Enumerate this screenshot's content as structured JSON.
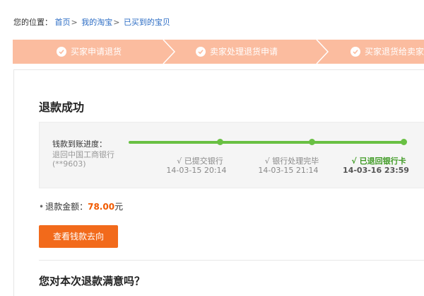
{
  "breadcrumb": {
    "prefix": "您的位置：",
    "items": [
      "首页",
      "我的淘宝",
      "已买到的宝贝"
    ],
    "separator": ">"
  },
  "steps": [
    {
      "label": "买家申请退货",
      "icon": "check-circle-icon"
    },
    {
      "label": "卖家处理退货申请",
      "icon": "check-circle-icon"
    },
    {
      "label": "买家退货给卖家",
      "icon": "check-circle-icon"
    }
  ],
  "refund": {
    "title": "退款成功",
    "progress_label": "钱款到账进度：",
    "destination": "退回中国工商银行",
    "card": "(**9603)",
    "stages": [
      {
        "status": "√ 已提交银行",
        "time": "14-03-15 20:14"
      },
      {
        "status": "√ 银行处理完毕",
        "time": "14-03-15 21:14"
      },
      {
        "status": "√ 已退回银行卡",
        "time": "14-03-16 23:59"
      }
    ],
    "amount_label": "退款金额：",
    "amount_value": "78.00",
    "amount_unit": "元",
    "view_button": "查看钱款去向",
    "satisfaction_question": "您对本次退款满意吗？"
  },
  "colors": {
    "steps_bg": "#fbbc9f",
    "progress_green": "#69c043",
    "accent_orange": "#f26a1b",
    "link_blue": "#2b6cc4"
  }
}
